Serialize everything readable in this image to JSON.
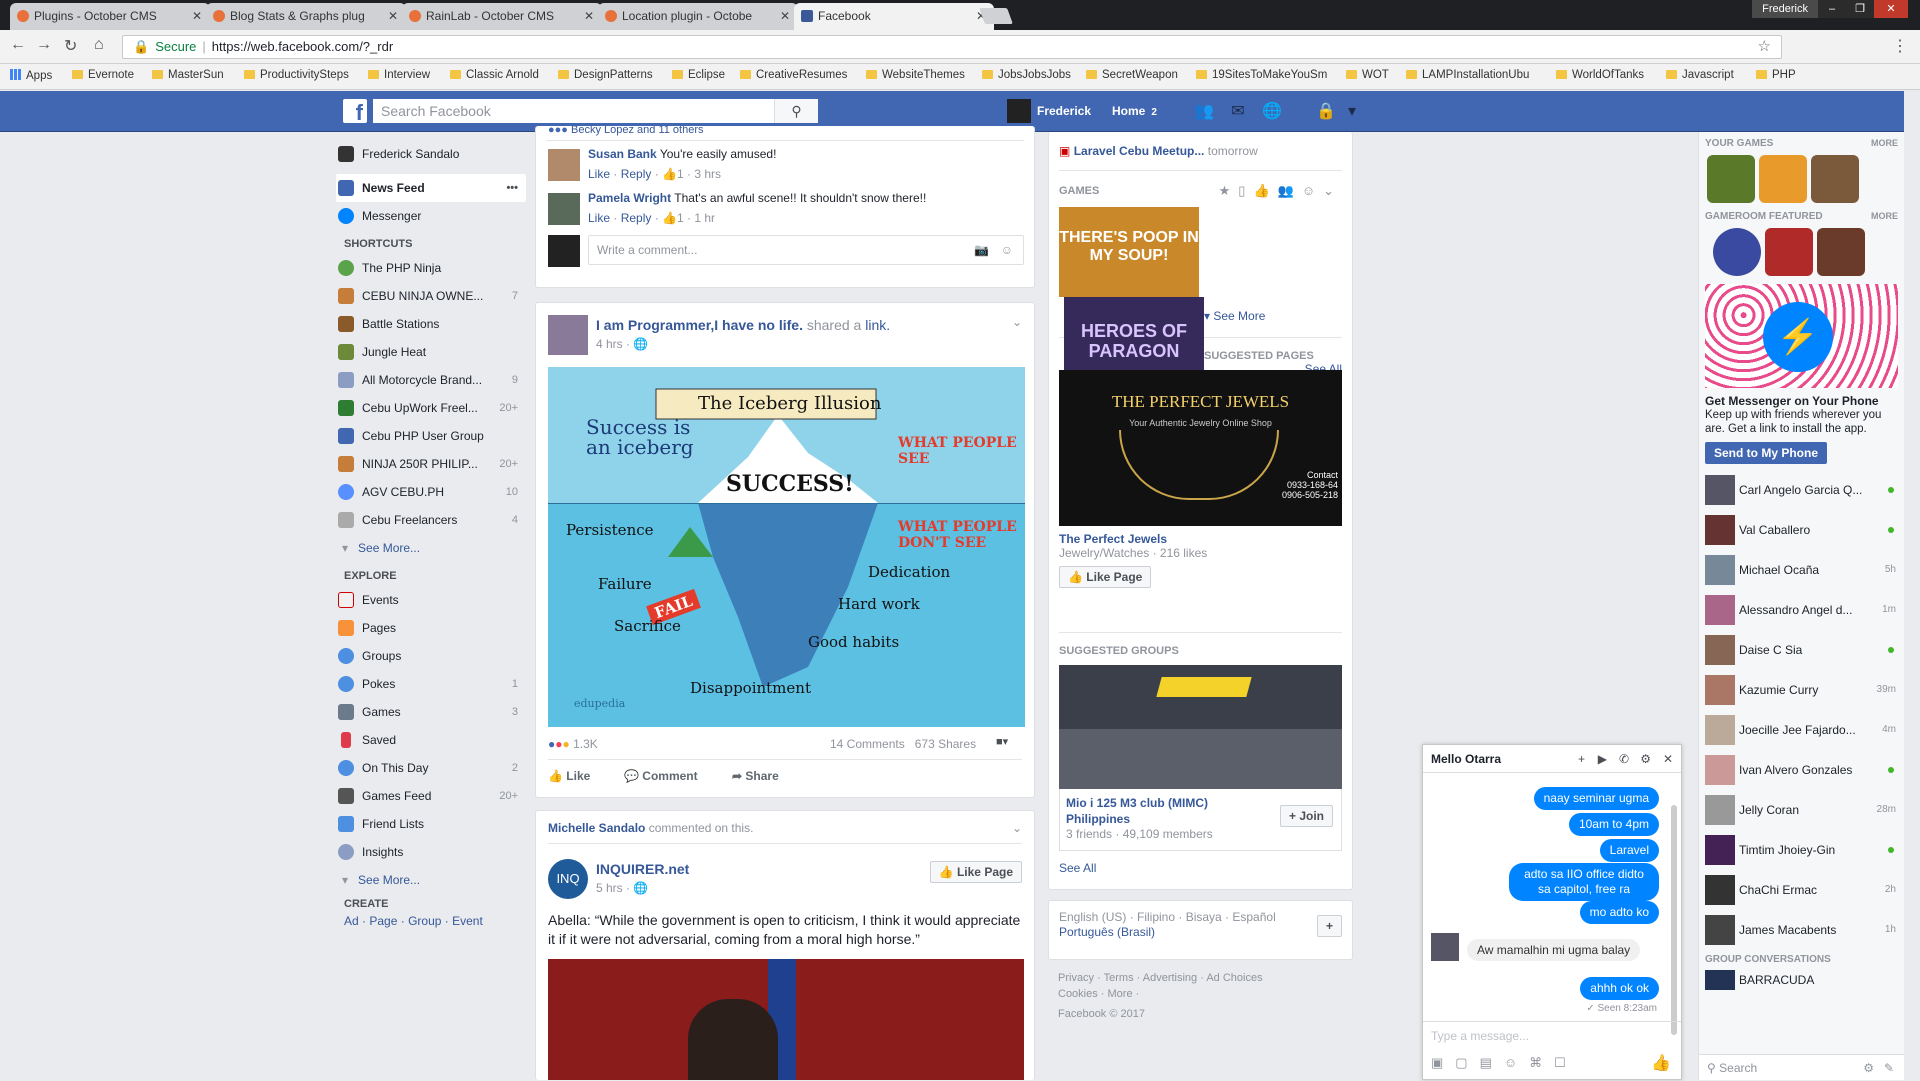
{
  "tabs": [
    {
      "label": "Plugins - October CMS"
    },
    {
      "label": "Blog Stats & Graphs plug"
    },
    {
      "label": "RainLab - October CMS"
    },
    {
      "label": "Location plugin - Octobe"
    },
    {
      "label": "Facebook"
    }
  ],
  "window_user": "Frederick",
  "address": {
    "secure": "Secure",
    "url": "https://web.facebook.com/?_rdr"
  },
  "bookmarks": [
    "Apps",
    "Evernote",
    "MasterSun",
    "ProductivitySteps",
    "Interview",
    "Classic Arnold",
    "DesignPatterns",
    "Eclipse",
    "CreativeResumes",
    "WebsiteThemes",
    "JobsJobsJobs",
    "SecretWeapon",
    "19SitesToMakeYouSm",
    "WOT",
    "LAMPInstallationUbu",
    "WorldOfTanks",
    "Javascript",
    "PHP"
  ],
  "fb": {
    "search_placeholder": "Search Facebook",
    "user": "Frederick",
    "home": "Home",
    "home_count": "2"
  },
  "left": {
    "profile": "Frederick Sandalo",
    "news_feed": "News Feed",
    "messenger": "Messenger",
    "shortcuts_title": "SHORTCUTS",
    "shortcuts": [
      {
        "label": "The PHP Ninja",
        "count": ""
      },
      {
        "label": "CEBU NINJA OWNE...",
        "count": "7"
      },
      {
        "label": "Battle Stations",
        "count": ""
      },
      {
        "label": "Jungle Heat",
        "count": ""
      },
      {
        "label": "All Motorcycle Brand...",
        "count": "9"
      },
      {
        "label": "Cebu UpWork Freel...",
        "count": "20+"
      },
      {
        "label": "Cebu PHP User Group",
        "count": ""
      },
      {
        "label": "NINJA 250R PHILIP...",
        "count": "20+"
      },
      {
        "label": "AGV CEBU.PH",
        "count": "10"
      },
      {
        "label": "Cebu Freelancers",
        "count": "4"
      }
    ],
    "see_more": "See More...",
    "explore_title": "EXPLORE",
    "explore": [
      {
        "label": "Events",
        "count": ""
      },
      {
        "label": "Pages",
        "count": ""
      },
      {
        "label": "Groups",
        "count": ""
      },
      {
        "label": "Pokes",
        "count": "1"
      },
      {
        "label": "Games",
        "count": "3"
      },
      {
        "label": "Saved",
        "count": ""
      },
      {
        "label": "On This Day",
        "count": "2"
      },
      {
        "label": "Games Feed",
        "count": "20+"
      },
      {
        "label": "Friend Lists",
        "count": ""
      },
      {
        "label": "Insights",
        "count": ""
      }
    ],
    "create_title": "CREATE",
    "create_links": [
      "Ad",
      "Page",
      "Group",
      "Event"
    ]
  },
  "feed": {
    "top_reactions": "Becky Lopez and 11 others",
    "comments": [
      {
        "name": "Susan Bank",
        "text": "You're easily amused!",
        "like": "Like",
        "reply": "Reply",
        "count": "1",
        "time": "3 hrs"
      },
      {
        "name": "Pamela Wright",
        "text": "That's an awful scene!! It shouldn't snow there!!",
        "like": "Like",
        "reply": "Reply",
        "count": "1",
        "time": "1 hr"
      }
    ],
    "write_comment": "Write a comment...",
    "post": {
      "author": "I am Programmer,I have no life.",
      "shared": "shared a",
      "link": "link.",
      "time": "4 hrs"
    },
    "ice": {
      "banner": "The Iceberg Illusion",
      "tagline": "Success is an iceberg",
      "success": "SUCCESS!",
      "people_see": "WHAT PEOPLE SEE",
      "people_dont": "WHAT PEOPLE DON'T SEE",
      "persistence": "Persistence",
      "failure": "Failure",
      "fail": "FAIL",
      "sacrifice": "Sacrifice",
      "dedication": "Dedication",
      "hard_work": "Hard work",
      "good_habits": "Good habits",
      "disappointment": "Disappointment",
      "brand": "edupedia"
    },
    "stats": {
      "reactions": "1.3K",
      "comments": "14 Comments",
      "shares": "673 Shares"
    },
    "actions": {
      "like": "Like",
      "comment": "Comment",
      "share": "Share"
    },
    "post2": {
      "commenter": "Michelle Sandalo",
      "commented": "commented on this.",
      "page": "INQUIRER.net",
      "time": "5 hrs",
      "like_page": "Like Page",
      "text": "Abella: “While the government is open to criticism, I think it would appreciate it if it were not adversarial, coming from a moral high horse.”"
    }
  },
  "right": {
    "event": "Laravel Cebu Meetup...",
    "event_when": "tomorrow",
    "games_title": "GAMES",
    "see_more": "See More",
    "game1": "THERE'S POOP IN MY SOUP!",
    "game2": "HEROES OF PARAGON",
    "sp_title": "SUGGESTED PAGES",
    "see_all": "See All",
    "page_name": "The Perfect Jewels",
    "page_img_title": "THE PERFECT JEWELS",
    "page_img_sub": "Your Authentic Jewelry Online Shop",
    "page_contact": "Contact",
    "page_phones": [
      "0933-168-64",
      "0906-505-218"
    ],
    "page_meta": "Jewelry/Watches · 216 likes",
    "like_page": "Like Page",
    "sg_title": "SUGGESTED GROUPS",
    "group_name": "Mio i 125 M3 club (MIMC) Philippines",
    "group_meta": "3 friends · 49,109 members",
    "join": "+ Join",
    "see_all2": "See All",
    "langs": "English (US) · Filipino · Bisaya · Español",
    "langs2": "Português (Brasil)",
    "footer1": "Privacy · Terms · Advertising · Ad Choices",
    "footer2": "Cookies · More ·",
    "copyright": "Facebook © 2017"
  },
  "sidebar": {
    "your_games": "YOUR GAMES",
    "more": "MORE",
    "gameroom": "GAMEROOM FEATURED",
    "more2": "MORE",
    "msg_title": "Get Messenger on Your Phone",
    "msg_text": "Keep up with friends wherever you are. Get a link to install the app.",
    "send_btn": "Send to My Phone",
    "contacts": [
      {
        "name": "Carl Angelo Garcia Q...",
        "status": "online",
        "time": ""
      },
      {
        "name": "Val Caballero",
        "status": "online",
        "time": ""
      },
      {
        "name": "Michael Ocaña",
        "status": "",
        "time": "5h"
      },
      {
        "name": "Alessandro Angel d...",
        "status": "",
        "time": "1m"
      },
      {
        "name": "Daise C Sia",
        "status": "online",
        "time": ""
      },
      {
        "name": "Kazumie Curry",
        "status": "",
        "time": "39m"
      },
      {
        "name": "Joecille Jee Fajardo...",
        "status": "",
        "time": "4m"
      },
      {
        "name": "Ivan Alvero Gonzales",
        "status": "online",
        "time": ""
      },
      {
        "name": "Jelly Coran",
        "status": "",
        "time": "28m"
      },
      {
        "name": "Timtim Jhoiey-Gin",
        "status": "online",
        "time": ""
      },
      {
        "name": "ChaChi Ermac",
        "status": "",
        "time": "2h"
      },
      {
        "name": "James Macabents",
        "status": "",
        "time": "1h"
      }
    ],
    "group_conv": "GROUP CONVERSATIONS",
    "group1": "BARRACUDA",
    "search": "Search"
  },
  "chat": {
    "name": "Mello Otarra",
    "messages": [
      "naay seminar ugma",
      "10am to 4pm",
      "Laravel",
      "adto sa IIO office didto sa capitol, free ra",
      "mo adto ko",
      "Aw mamalhin mi ugma balay",
      "ahhh ok ok"
    ],
    "seen": "Seen 8:23am",
    "placeholder": "Type a message..."
  }
}
